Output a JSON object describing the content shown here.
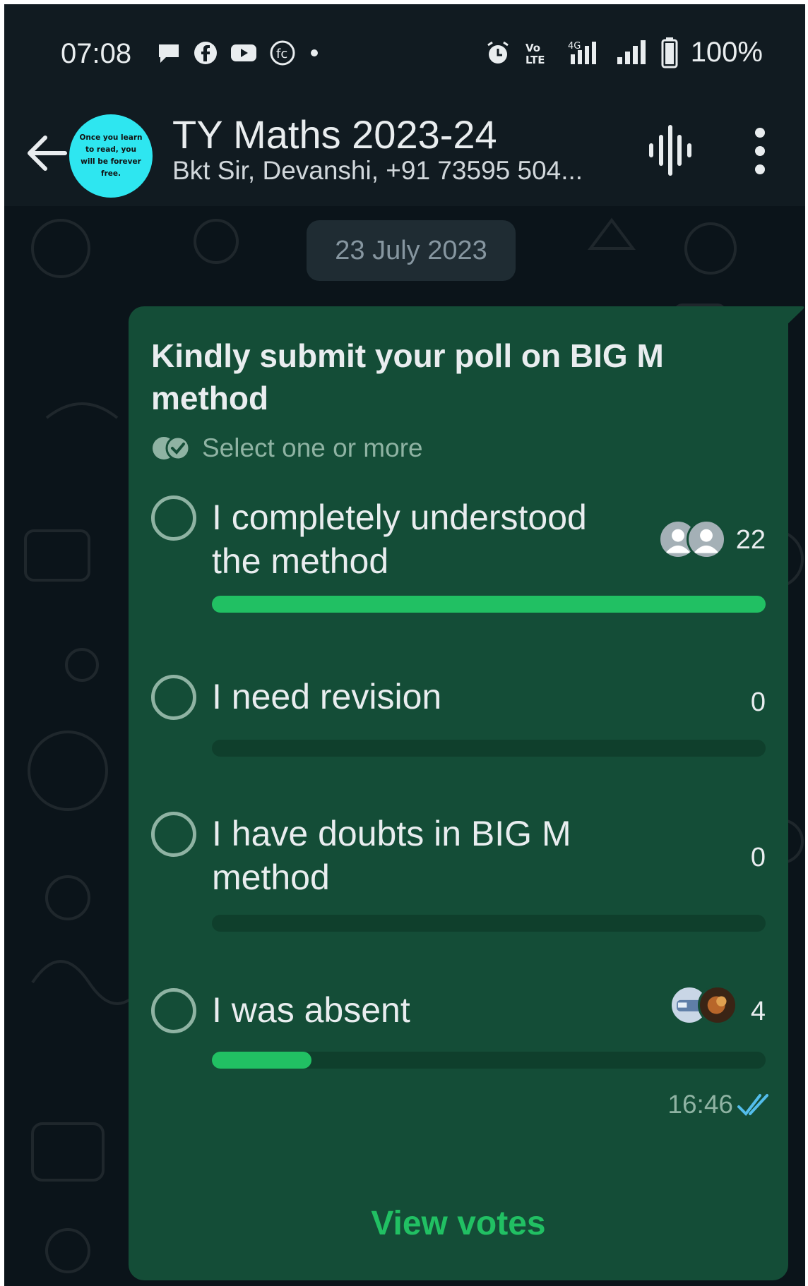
{
  "status_bar": {
    "time": "07:08",
    "battery": "100%",
    "icons": [
      "chat-bubble-icon",
      "facebook-icon",
      "youtube-icon",
      "app-icon",
      "dot-icon",
      "alarm-icon",
      "volte-icon",
      "4g-signal-icon",
      "signal-icon",
      "battery-icon"
    ]
  },
  "header": {
    "title": "TY Maths 2023-24",
    "members": "Bkt Sir, Devanshi, +91 73595 504...",
    "avatar_text": "Once you learn to read, you will be forever free."
  },
  "chat": {
    "date_chip": "23 July 2023"
  },
  "poll": {
    "question": "Kindly submit your poll on BIG M method",
    "hint": "Select one or more",
    "options": [
      {
        "label": "I completely understood the method",
        "count": "22",
        "fraction": 1.0
      },
      {
        "label": "I need revision",
        "count": "0",
        "fraction": 0.0
      },
      {
        "label": "I have doubts in BIG M method",
        "count": "0",
        "fraction": 0.0
      },
      {
        "label": "I was absent",
        "count": "4",
        "fraction": 0.18
      }
    ],
    "time": "16:46",
    "view_votes": "View votes"
  },
  "colors": {
    "bubble": "#144d37",
    "accent": "#21c063",
    "background": "#0b141a",
    "header": "#111b21"
  }
}
